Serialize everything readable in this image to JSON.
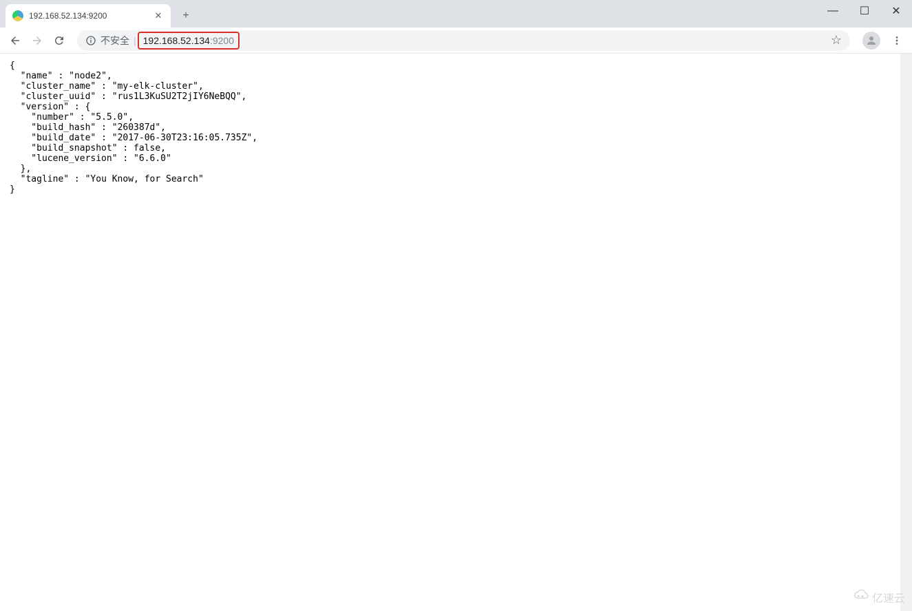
{
  "window": {
    "minimize": "—",
    "maximize": "☐",
    "close": "✕"
  },
  "tab": {
    "title": "192.168.52.134:9200",
    "close": "✕",
    "new": "+"
  },
  "address": {
    "insecure": "不安全",
    "url_host": "192.168.52.134",
    "url_port": ":9200"
  },
  "body": {
    "name_key": "name",
    "name_val": "node2",
    "cluster_name_key": "cluster_name",
    "cluster_name_val": "my-elk-cluster",
    "cluster_uuid_key": "cluster_uuid",
    "cluster_uuid_val": "rus1L3KuSU2T2jIY6NeBQQ",
    "version_key": "version",
    "number_key": "number",
    "number_val": "5.5.0",
    "build_hash_key": "build_hash",
    "build_hash_val": "260387d",
    "build_date_key": "build_date",
    "build_date_val": "2017-06-30T23:16:05.735Z",
    "build_snapshot_key": "build_snapshot",
    "build_snapshot_val": "false",
    "lucene_version_key": "lucene_version",
    "lucene_version_val": "6.6.0",
    "tagline_key": "tagline",
    "tagline_val": "You Know, for Search"
  },
  "watermark": {
    "text": "亿速云"
  }
}
